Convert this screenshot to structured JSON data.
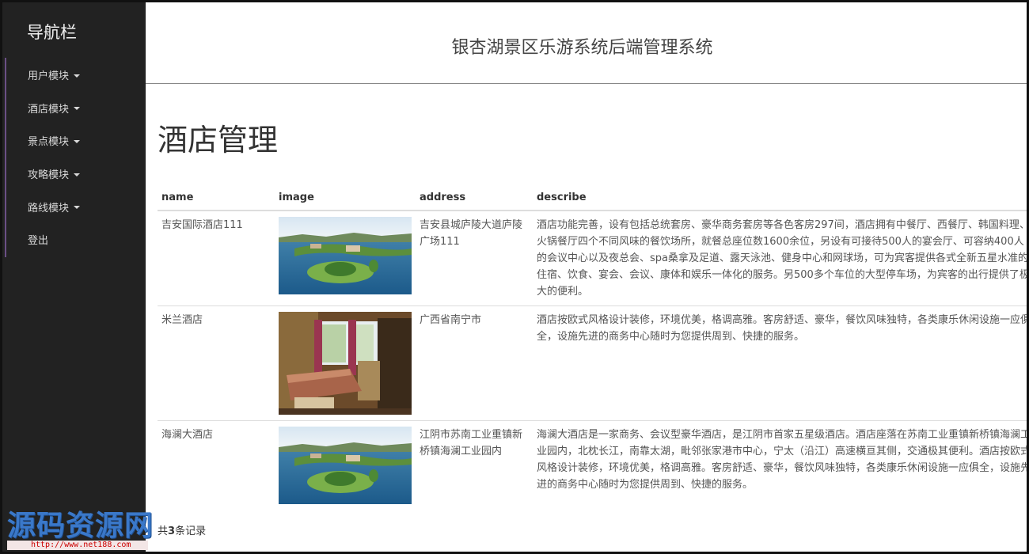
{
  "sidebar": {
    "brand": "导航栏",
    "items": [
      {
        "label": "用户模块",
        "dropdown": true
      },
      {
        "label": "酒店模块",
        "dropdown": true
      },
      {
        "label": "景点模块",
        "dropdown": true
      },
      {
        "label": "攻略模块",
        "dropdown": true
      },
      {
        "label": "路线模块",
        "dropdown": true
      },
      {
        "label": "登出",
        "dropdown": false
      }
    ]
  },
  "header": {
    "title": "银杏湖景区乐游系统后端管理系统"
  },
  "page": {
    "heading": "酒店管理"
  },
  "table": {
    "columns": [
      "name",
      "image",
      "address",
      "describe"
    ],
    "rows": [
      {
        "name": "吉安国际酒店111",
        "image": "lake-island-photo",
        "address": "吉安县城庐陵大道庐陵广场111",
        "describe": "酒店功能完善，设有包括总统套房、豪华商务套房等各色客房297间，酒店拥有中餐厅、西餐厅、韩国料理、火锅餐厅四个不同风味的餐饮场所，就餐总座位数1600余位，另设有可接待500人的宴会厅、可容纳400人的会议中心以及夜总会、spa桑拿及足道、露天泳池、健身中心和网球场，可为宾客提供各式全新五星水准的住宿、饮食、宴会、会议、康体和娱乐一体化的服务。另500多个车位的大型停车场，为宾客的出行提供了极大的便利。"
      },
      {
        "name": "米兰酒店",
        "image": "hotel-room-photo",
        "address": "广西省南宁市",
        "describe": "酒店按欧式风格设计装修，环境优美，格调高雅。客房舒适、豪华，餐饮风味独特，各类康乐休闲设施一应俱全，设施先进的商务中心随时为您提供周到、快捷的服务。"
      },
      {
        "name": "海澜大酒店",
        "image": "lake-island-photo",
        "address": "江阴市苏南工业重镇新桥镇海澜工业园内",
        "describe": "海澜大酒店是一家商务、会议型豪华酒店，是江阴市首家五星级酒店。酒店座落在苏南工业重镇新桥镇海澜工业园内，北枕长江，南靠太湖，毗邻张家港市中心，宁太（沿江）高速横亘其侧，交通极其便利。酒店按欧式风格设计装修，环境优美，格调高雅。客房舒适、豪华，餐饮风味独特，各类康乐休闲设施一应俱全，设施先进的商务中心随时为您提供周到、快捷的服务。"
      }
    ]
  },
  "footer": {
    "prefix": "共",
    "count": "3",
    "suffix": "条记录"
  },
  "watermark": {
    "text": "源码资源网",
    "url": "http://www.net188.com"
  }
}
